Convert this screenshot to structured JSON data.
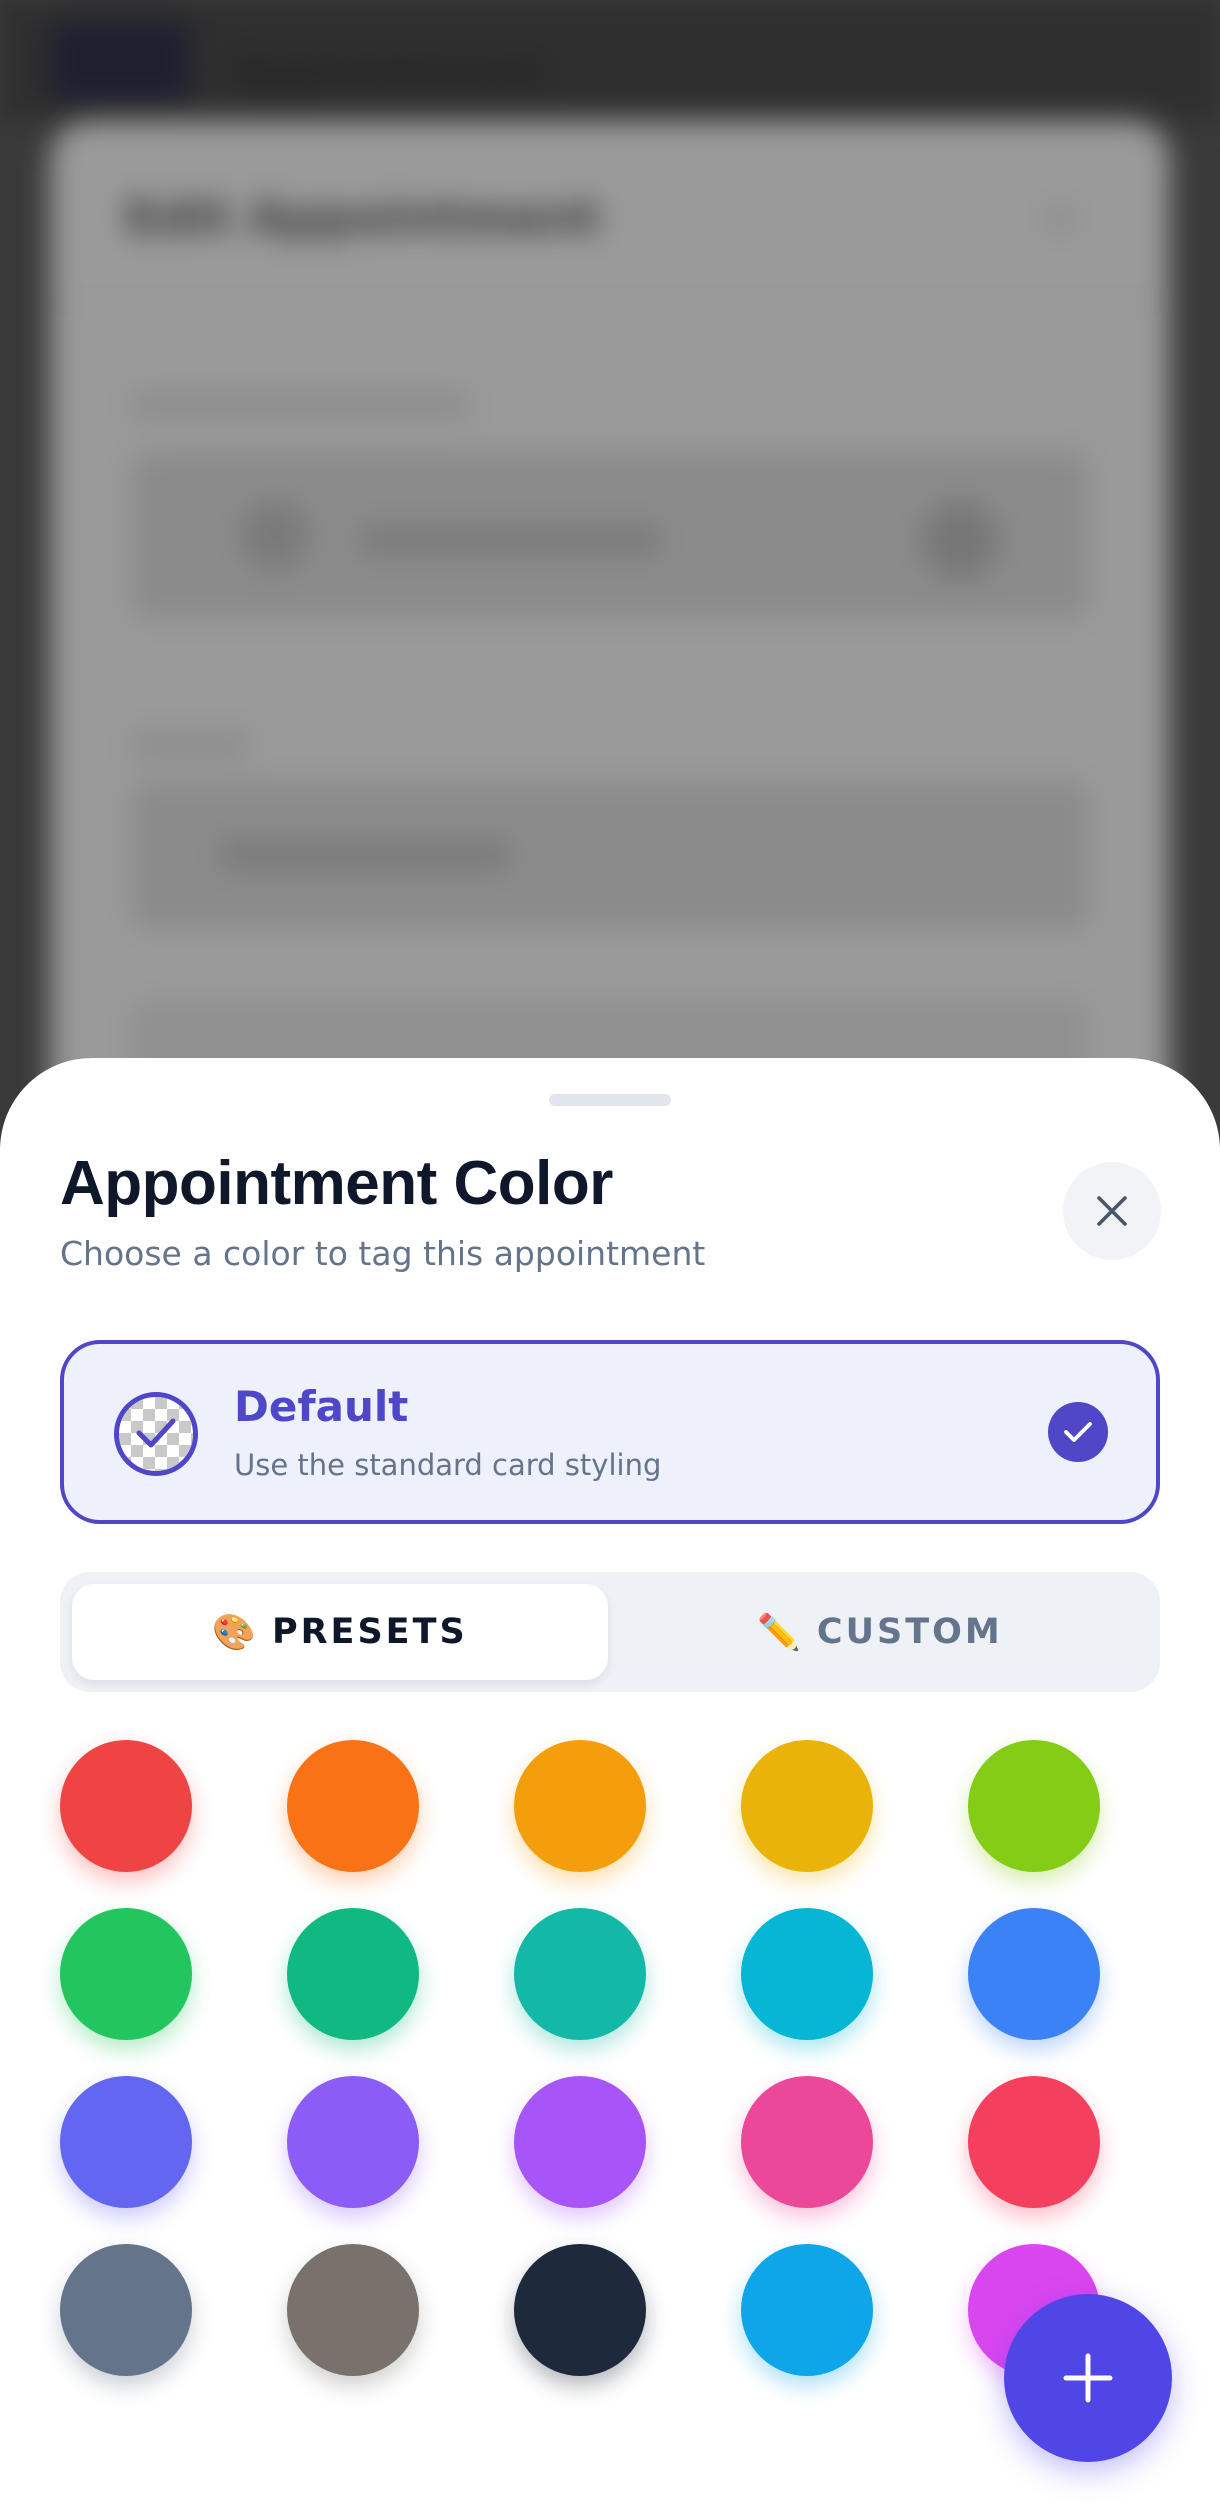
{
  "background": {
    "app_title": "Appointments",
    "card_title": "Edit Appointment"
  },
  "sheet": {
    "title": "Appointment Color",
    "subtitle": "Choose a color to tag this appointment",
    "close_icon": "close-icon"
  },
  "default_option": {
    "name": "Default",
    "description": "Use the standard card styling",
    "selected": true,
    "accent": "#4f46c8"
  },
  "tabs": [
    {
      "emoji": "🎨",
      "label": "PRESETS",
      "active": true
    },
    {
      "emoji": "✏️",
      "label": "CUSTOM",
      "active": false
    }
  ],
  "swatches": [
    {
      "name": "red",
      "color": "#ef4444"
    },
    {
      "name": "orange",
      "color": "#f97316"
    },
    {
      "name": "amber",
      "color": "#f59e0b"
    },
    {
      "name": "yellow",
      "color": "#eab308"
    },
    {
      "name": "lime",
      "color": "#84cc16"
    },
    {
      "name": "green",
      "color": "#22c55e"
    },
    {
      "name": "emerald",
      "color": "#10b981"
    },
    {
      "name": "teal",
      "color": "#14b8a6"
    },
    {
      "name": "cyan",
      "color": "#06b6d4"
    },
    {
      "name": "blue",
      "color": "#3b82f6"
    },
    {
      "name": "indigo",
      "color": "#6366f1"
    },
    {
      "name": "violet",
      "color": "#8b5cf6"
    },
    {
      "name": "purple",
      "color": "#a855f7"
    },
    {
      "name": "pink",
      "color": "#ec4899"
    },
    {
      "name": "rose",
      "color": "#f43f5e"
    },
    {
      "name": "slate",
      "color": "#64748b"
    },
    {
      "name": "stone",
      "color": "#78716c"
    },
    {
      "name": "navy",
      "color": "#1e293b"
    },
    {
      "name": "sky",
      "color": "#0ea5e9"
    },
    {
      "name": "fuchsia",
      "color": "#d946ef"
    }
  ],
  "fab": {
    "icon": "plus-icon",
    "color": "#4f46e5"
  }
}
